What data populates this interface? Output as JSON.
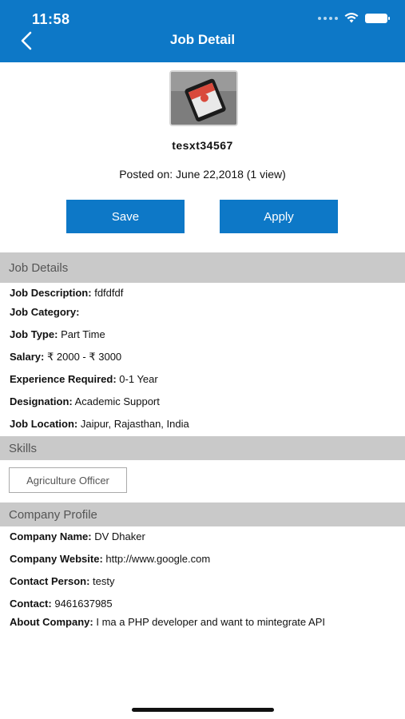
{
  "status_bar": {
    "time": "11:58"
  },
  "header": {
    "title": "Job Detail"
  },
  "job": {
    "name": "tesxt34567",
    "posted": "Posted on: June 22,2018 (1 view)"
  },
  "actions": {
    "save_label": "Save",
    "apply_label": "Apply"
  },
  "sections": {
    "job_details": "Job Details",
    "skills": "Skills",
    "company_profile": "Company Profile"
  },
  "details": [
    {
      "label": "Job Description:",
      "value": "fdfdfdf"
    },
    {
      "label": "Job Category:",
      "value": ""
    },
    {
      "label": "Job Type:",
      "value": "Part Time"
    },
    {
      "label": "Salary:",
      "value": "₹ 2000 - ₹ 3000"
    },
    {
      "label": "Experience Required:",
      "value": "0-1 Year"
    },
    {
      "label": "Designation:",
      "value": "Academic Support"
    },
    {
      "label": "Job Location:",
      "value": "Jaipur, Rajasthan, India"
    }
  ],
  "skills": [
    "Agriculture Officer"
  ],
  "company": [
    {
      "label": "Company Name:",
      "value": "DV Dhaker"
    },
    {
      "label": "Company Website:",
      "value": "http://www.google.com"
    },
    {
      "label": "Contact Person:",
      "value": "testy"
    },
    {
      "label": "Contact:",
      "value": "9461637985"
    },
    {
      "label": "About Company:",
      "value": "I ma a PHP developer and want to mintegrate API"
    }
  ],
  "colors": {
    "primary": "#0d78c7",
    "section_bg": "#c9c9c9"
  },
  "icons": {
    "back": "chevron-left-icon",
    "wifi": "wifi-icon",
    "battery": "battery-icon",
    "signal": "signal-icon"
  }
}
